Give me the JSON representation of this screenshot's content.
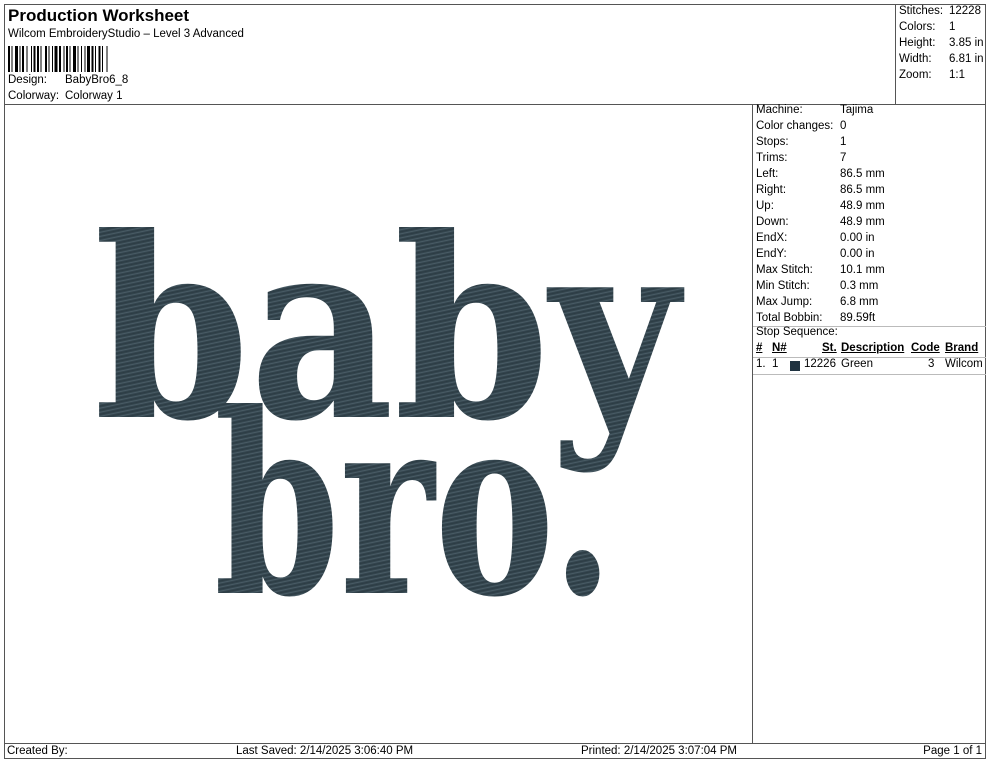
{
  "header": {
    "title": "Production Worksheet",
    "subtitle": "Wilcom EmbroideryStudio – Level 3 Advanced",
    "design_label": "Design:",
    "design_value": "BabyBro6_8",
    "colorway_label": "Colorway:",
    "colorway_value": "Colorway 1"
  },
  "summary": [
    {
      "label": "Stitches:",
      "value": "12228"
    },
    {
      "label": "Colors:",
      "value": "1"
    },
    {
      "label": "Height:",
      "value": "3.85 in"
    },
    {
      "label": "Width:",
      "value": "6.81 in"
    },
    {
      "label": "Zoom:",
      "value": "1:1"
    }
  ],
  "properties": [
    {
      "label": "Machine:",
      "value": "Tajima"
    },
    {
      "label": "Color changes:",
      "value": "0"
    },
    {
      "label": "Stops:",
      "value": "1"
    },
    {
      "label": "Trims:",
      "value": "7"
    },
    {
      "label": "Left:",
      "value": "86.5 mm"
    },
    {
      "label": "Right:",
      "value": "86.5 mm"
    },
    {
      "label": "Up:",
      "value": "48.9 mm"
    },
    {
      "label": "Down:",
      "value": "48.9 mm"
    },
    {
      "label": "EndX:",
      "value": "0.00 in"
    },
    {
      "label": "EndY:",
      "value": "0.00 in"
    },
    {
      "label": "Max Stitch:",
      "value": "10.1 mm"
    },
    {
      "label": "Min Stitch:",
      "value": "0.3 mm"
    },
    {
      "label": "Max Jump:",
      "value": "6.8 mm"
    },
    {
      "label": "Total Bobbin:",
      "value": "89.59ft"
    }
  ],
  "stop_sequence": {
    "title": "Stop Sequence:",
    "columns": {
      "num": "#",
      "n": "N#",
      "st": "St.",
      "description": "Description",
      "code": "Code",
      "brand": "Brand"
    },
    "rows": [
      {
        "num": "1.",
        "n": "1",
        "st": "12226",
        "description": "Green",
        "code": "3",
        "brand": "Wilcom",
        "color": "#1f3240"
      }
    ]
  },
  "design": {
    "line1": "baby",
    "line2": "bro.",
    "thread_color": "#34454e"
  },
  "footer": {
    "created_by": "Created By:",
    "last_saved": "Last Saved: 2/14/2025 3:06:40 PM",
    "printed": "Printed: 2/14/2025 3:07:04 PM",
    "page": "Page 1 of 1"
  }
}
